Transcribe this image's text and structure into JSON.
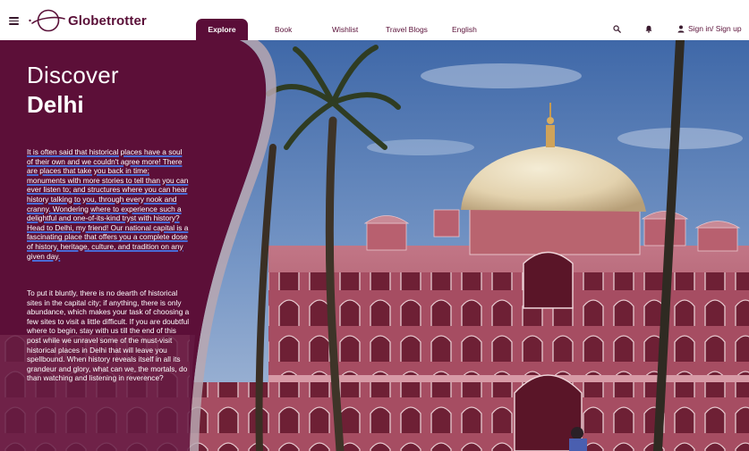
{
  "brand": {
    "name": "Globetrotter"
  },
  "nav": {
    "tabs": [
      {
        "label": "Explore",
        "active": true
      },
      {
        "label": "Book",
        "active": false
      },
      {
        "label": "Wishlist",
        "active": false
      },
      {
        "label": "Travel Blogs",
        "active": false
      },
      {
        "label": "English",
        "active": false
      }
    ],
    "icons": [
      "search-icon",
      "bell-icon",
      "user-icon",
      "menu-icon"
    ],
    "sign_in_label": "Sign in/ Sign up"
  },
  "hero": {
    "title_line1": "Discover",
    "title_line2": "Delhi",
    "paragraph1": "It is often said that historical places have a soul of their own and we couldn't agree more! There are places that take you back in time; monuments with more stories to tell than you can ever listen to; and structures where you can hear history talking to you, through every nook and cranny. Wondering where to experience such a delightful and one-of-its-kind tryst with history? Head to Delhi, my friend! Our national capital is a fascinating place that offers you a complete dose of history, heritage, culture, and tradition on any given day.",
    "paragraph2": "To put it bluntly, there is no dearth of historical sites in the capital city; if anything, there is only abundance, which makes your task of choosing a few sites to visit a little difficult. If you are doubtful where to begin, stay with us till the end of this post while we unravel some of the must-visit historical places in Delhi that will leave you spellbound. When history reveals itself in all its grandeur and glory, what can we, the mortals, do than watching and listening in reverence?"
  },
  "colors": {
    "brand": "#5a1038",
    "panel": "#5c0f38",
    "sky": "#4f78b8",
    "dome": "#e8dcc0",
    "sandstone": "#b0566a",
    "underline": "#4a6bd6"
  }
}
